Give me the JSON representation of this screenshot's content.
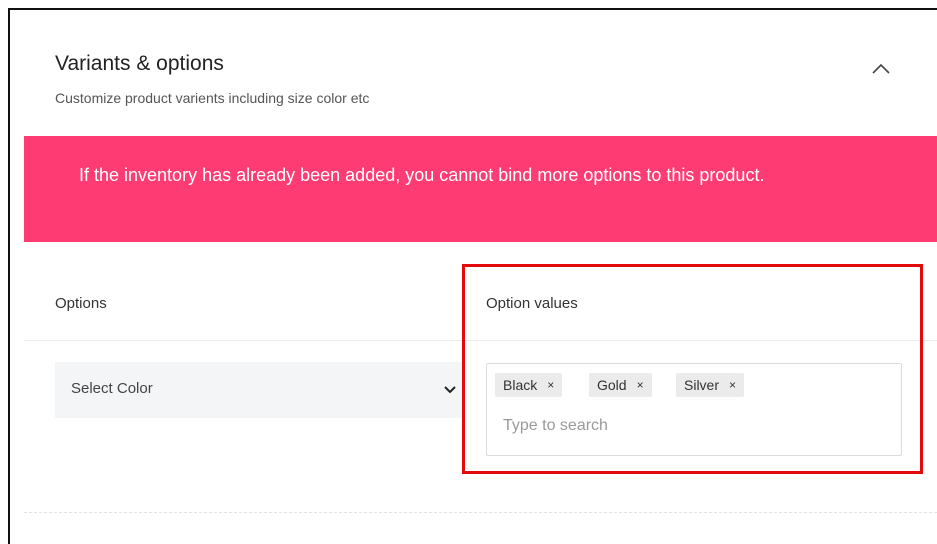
{
  "section": {
    "title": "Variants & options",
    "subtitle": "Customize product varients including size color etc"
  },
  "alert": {
    "text": "If the inventory has already been added, you cannot bind more options to this product.",
    "color": "#ff3b74"
  },
  "columns": {
    "options_label": "Options",
    "values_label": "Option values"
  },
  "option_select": {
    "selected": "Select Color"
  },
  "option_values": {
    "tags": [
      "Black",
      "Gold",
      "Silver"
    ],
    "remove_glyph": "×",
    "placeholder": "Type to search"
  },
  "icons": {
    "collapse": "chevron-up-icon",
    "select_dropdown": "chevron-down-icon"
  },
  "highlight_color": "#e20a0a"
}
